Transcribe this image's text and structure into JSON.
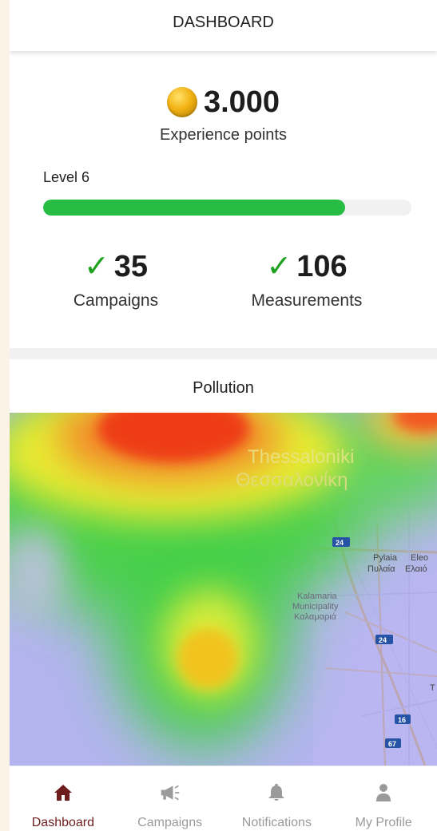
{
  "app_bar": {
    "title": "DASHBOARD"
  },
  "xp": {
    "value": "3.000",
    "label": "Experience points"
  },
  "level": {
    "label": "Level 6",
    "progress_fraction": 0.82
  },
  "stats": {
    "campaigns": {
      "value": "35",
      "label": "Campaigns"
    },
    "measurements": {
      "value": "106",
      "label": "Measurements"
    }
  },
  "section": {
    "title": "Pollution"
  },
  "map": {
    "city_latin": "Thessaloniki",
    "city_greek": "Θεσσαλονίκη",
    "pylaia_latin": "Pylaia",
    "pylaia_greek": "Πυλαία",
    "eleo_latin": "Eleo",
    "eleo_greek": "Ελαιό",
    "kalamaria_1": "Kalamaria",
    "kalamaria_2": "Municipality",
    "kalamaria_greek": "Καλαμαριά",
    "road_24": "24",
    "road_16": "16",
    "road_67": "67",
    "edge_letter": "T"
  },
  "nav": {
    "items": [
      {
        "label": "Dashboard",
        "icon": "home-icon",
        "active": true
      },
      {
        "label": "Campaigns",
        "icon": "megaphone-icon",
        "active": false
      },
      {
        "label": "Notifications",
        "icon": "bell-icon",
        "active": false
      },
      {
        "label": "My Profile",
        "icon": "user-icon",
        "active": false
      }
    ]
  },
  "colors": {
    "accent_green": "#27bd45",
    "check_green": "#1fa31f",
    "nav_active": "#6e1d1d",
    "nav_inactive": "#9a9a9a"
  }
}
